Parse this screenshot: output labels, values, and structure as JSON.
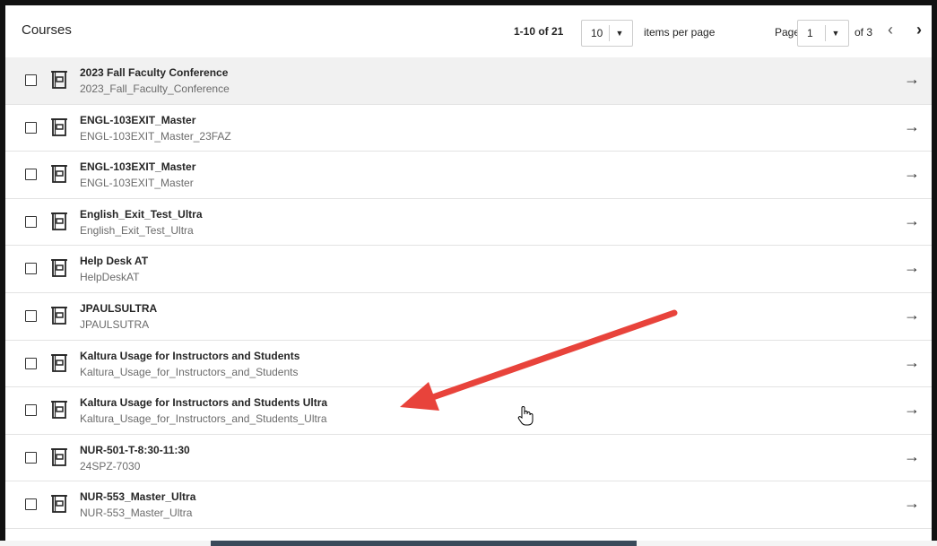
{
  "header": {
    "title": "Courses",
    "range": "1-10 of 21",
    "per_page_value": "10",
    "per_page_label": "items per page",
    "page_label": "Page",
    "page_value": "1",
    "of_label": "of 3",
    "prev_glyph": "‹",
    "next_glyph": "›"
  },
  "arrow_glyph": "→",
  "icons": {
    "course": "course-book-icon",
    "row_action": "arrow-right-icon",
    "cursor": "hand-pointer-icon",
    "annotation": "red-arrow-annotation"
  },
  "colors": {
    "annotation": "#e8433b",
    "selected_row_bg": "#f1f1f1",
    "frame": "#111111"
  },
  "courses": [
    {
      "title": "2023 Fall Faculty Conference",
      "id": "2023_Fall_Faculty_Conference"
    },
    {
      "title": "ENGL-103EXIT_Master",
      "id": "ENGL-103EXIT_Master_23FAZ"
    },
    {
      "title": "ENGL-103EXIT_Master",
      "id": "ENGL-103EXIT_Master"
    },
    {
      "title": "English_Exit_Test_Ultra",
      "id": "English_Exit_Test_Ultra"
    },
    {
      "title": "Help Desk AT",
      "id": "HelpDeskAT"
    },
    {
      "title": "JPAULSULTRA",
      "id": "JPAULSUTRA"
    },
    {
      "title": "Kaltura Usage for Instructors and Students",
      "id": "Kaltura_Usage_for_Instructors_and_Students"
    },
    {
      "title": "Kaltura Usage for Instructors and Students Ultra",
      "id": "Kaltura_Usage_for_Instructors_and_Students_Ultra"
    },
    {
      "title": "NUR-501-T-8:30-11:30",
      "id": "24SPZ-7030"
    },
    {
      "title": "NUR-553_Master_Ultra",
      "id": "NUR-553_Master_Ultra"
    }
  ]
}
